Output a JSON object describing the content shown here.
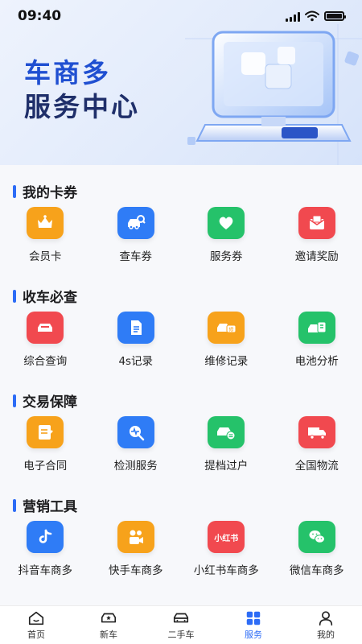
{
  "status_bar": {
    "time": "09:40"
  },
  "hero": {
    "title_line1": "车商多",
    "title_line2": "服务中心"
  },
  "sections": [
    {
      "title": "我的卡券",
      "items": [
        {
          "label": "会员卡",
          "icon": "crown-icon",
          "color": "#f7a21b"
        },
        {
          "label": "查车券",
          "icon": "car-search-icon",
          "color": "#2f7cf6"
        },
        {
          "label": "服务券",
          "icon": "heart-icon",
          "color": "#25c26a"
        },
        {
          "label": "邀请奖励",
          "icon": "envelope-icon",
          "color": "#f1494f"
        }
      ]
    },
    {
      "title": "收车必查",
      "items": [
        {
          "label": "综合查询",
          "icon": "car-icon",
          "color": "#f1494f"
        },
        {
          "label": "4s记录",
          "icon": "document-icon",
          "color": "#2f7cf6"
        },
        {
          "label": "维修记录",
          "icon": "car-repair-icon",
          "color": "#f7a21b"
        },
        {
          "label": "电池分析",
          "icon": "battery-car-icon",
          "color": "#25c26a"
        }
      ]
    },
    {
      "title": "交易保障",
      "items": [
        {
          "label": "电子合同",
          "icon": "contract-icon",
          "color": "#f7a21b"
        },
        {
          "label": "检测服务",
          "icon": "inspect-icon",
          "color": "#2f7cf6"
        },
        {
          "label": "提档过户",
          "icon": "car-transfer-icon",
          "color": "#25c26a"
        },
        {
          "label": "全国物流",
          "icon": "truck-icon",
          "color": "#f1494f"
        }
      ]
    },
    {
      "title": "营销工具",
      "items": [
        {
          "label": "抖音车商多",
          "icon": "douyin-icon",
          "color": "#2f7cf6"
        },
        {
          "label": "快手车商多",
          "icon": "kuaishou-icon",
          "color": "#f7a21b"
        },
        {
          "label": "小红书车商多",
          "icon": "xiaohongshu-icon",
          "color": "#f1494f",
          "badge_text": "小红书"
        },
        {
          "label": "微信车商多",
          "icon": "wechat-icon",
          "color": "#25c26a"
        }
      ]
    }
  ],
  "tabbar": {
    "active_color": "#2d6cf6",
    "tabs": [
      {
        "label": "首页",
        "icon": "home-icon",
        "active": false
      },
      {
        "label": "新车",
        "icon": "new-car-icon",
        "active": false
      },
      {
        "label": "二手车",
        "icon": "used-car-icon",
        "active": false
      },
      {
        "label": "服务",
        "icon": "grid-icon",
        "active": true
      },
      {
        "label": "我的",
        "icon": "user-icon",
        "active": false
      }
    ]
  }
}
